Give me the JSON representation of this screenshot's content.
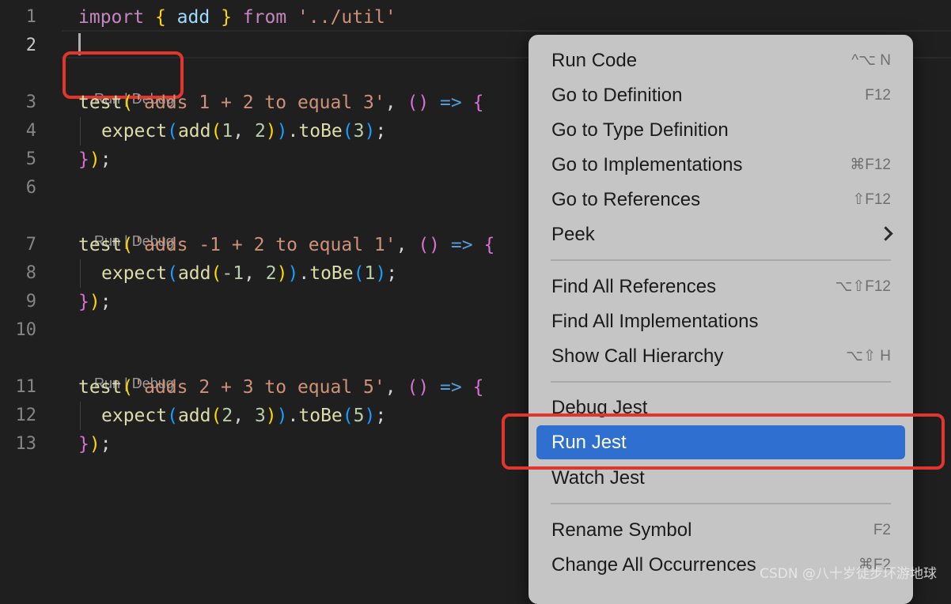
{
  "editor": {
    "line_numbers": [
      "1",
      "2",
      "3",
      "4",
      "5",
      "6",
      "7",
      "8",
      "9",
      "10",
      "11",
      "12",
      "13"
    ],
    "code_lens": {
      "run": "Run",
      "sep": " | ",
      "debug": "Debug"
    },
    "lines": {
      "l1": [
        "import",
        "{",
        "add",
        "}",
        "from",
        "'../util'"
      ],
      "l3": [
        "test",
        "(",
        "'adds 1 + 2 to equal 3'",
        ",",
        "()",
        "=>",
        "{"
      ],
      "l4": [
        "expect",
        "(",
        "add",
        "(",
        "1",
        ",",
        "2",
        ")",
        ")",
        ".",
        "toBe",
        "(",
        "3",
        ")",
        ";"
      ],
      "l5": [
        "}",
        ")",
        ";"
      ],
      "l7": [
        "test",
        "(",
        "'adds -1 + 2 to equal 1'",
        ",",
        "()",
        "=>",
        "{"
      ],
      "l8": [
        "expect",
        "(",
        "add",
        "(",
        "-1",
        ",",
        "2",
        ")",
        ")",
        ".",
        "toBe",
        "(",
        "1",
        ")",
        ";"
      ],
      "l9": [
        "}",
        ")",
        ";"
      ],
      "l11": [
        "test",
        "(",
        "'adds 2 + 3 to equal 5'",
        ",",
        "()",
        "=>",
        "{"
      ],
      "l12": [
        "expect",
        "(",
        "add",
        "(",
        "2",
        ",",
        "3",
        ")",
        ")",
        ".",
        "toBe",
        "(",
        "5",
        ")",
        ";"
      ],
      "l13": [
        "}",
        ")",
        ";"
      ]
    }
  },
  "context_menu": {
    "items": [
      {
        "label": "Run Code",
        "shortcut": "^⌥ N"
      },
      {
        "label": "Go to Definition",
        "shortcut": "F12"
      },
      {
        "label": "Go to Type Definition",
        "shortcut": ""
      },
      {
        "label": "Go to Implementations",
        "shortcut": "⌘F12"
      },
      {
        "label": "Go to References",
        "shortcut": "⇧F12"
      },
      {
        "label": "Peek",
        "shortcut": ""
      },
      {
        "label": "Find All References",
        "shortcut": "⌥⇧F12"
      },
      {
        "label": "Find All Implementations",
        "shortcut": ""
      },
      {
        "label": "Show Call Hierarchy",
        "shortcut": "⌥⇧ H"
      },
      {
        "label": "Debug Jest",
        "shortcut": ""
      },
      {
        "label": "Run Jest",
        "shortcut": ""
      },
      {
        "label": "Watch Jest",
        "shortcut": ""
      },
      {
        "label": "Rename Symbol",
        "shortcut": "F2"
      },
      {
        "label": "Change All Occurrences",
        "shortcut": "⌘F2"
      }
    ],
    "selected": "Run Jest"
  },
  "watermark": "CSDN @八十岁徒步环游地球",
  "colors": {
    "editor_bg": "#1f1f1f",
    "menu_bg": "#c5c5c6",
    "selection": "#2f6fd0",
    "highlight_box": "#e0362d"
  }
}
